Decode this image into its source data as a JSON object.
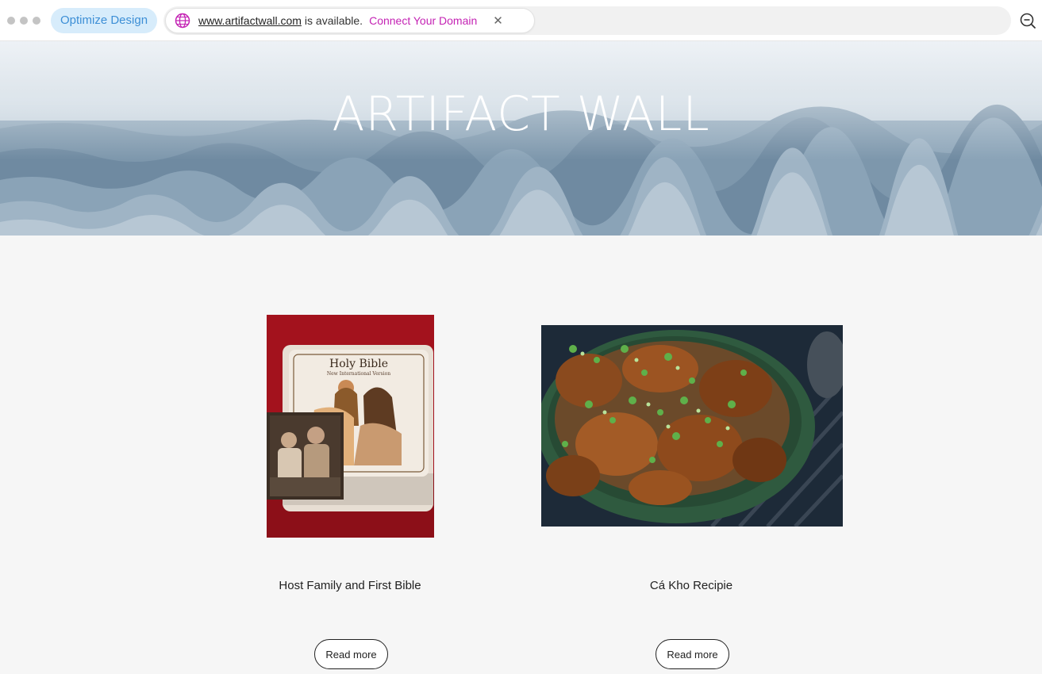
{
  "topbar": {
    "optimize_label": "Optimize Design",
    "domain_url": "www.artifactwall.com",
    "domain_available_text": "is available.",
    "connect_label": "Connect Your Domain",
    "close_symbol": "✕",
    "globe_icon": "globe-icon",
    "zoom_icon": "zoom-out-icon"
  },
  "hero": {
    "title": "ARTIFACT WALL"
  },
  "posts": [
    {
      "title": "Host Family and First Bible",
      "read_more": "Read more",
      "image": "bible-photo"
    },
    {
      "title": "Cá Kho Recipie",
      "read_more": "Read more",
      "image": "ca-kho-photo"
    }
  ],
  "colors": {
    "accent_pink": "#c423b4",
    "optimize_bg": "#d7ecfb",
    "optimize_text": "#3d8fd6",
    "page_bg": "#f6f6f6"
  }
}
